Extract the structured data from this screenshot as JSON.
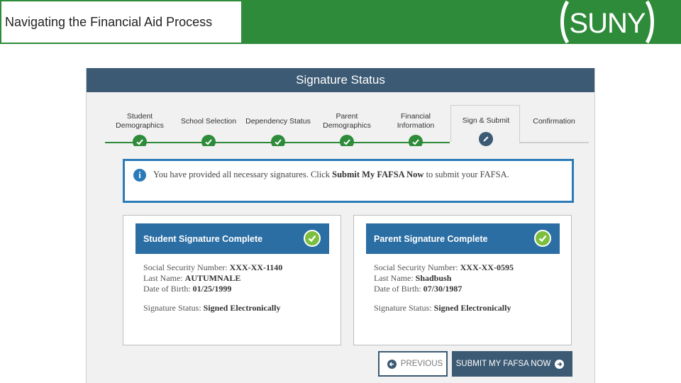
{
  "slide": {
    "title": "Navigating the Financial Aid Process",
    "logo_text": "SUNY",
    "colors": {
      "header_green": "#2e8b3a"
    }
  },
  "screen": {
    "title": "Signature Status",
    "steps": [
      {
        "line1": "Student",
        "line2": "Demographics",
        "state": "complete"
      },
      {
        "line1": "School Selection",
        "line2": "",
        "state": "complete"
      },
      {
        "line1": "Dependency Status",
        "line2": "",
        "state": "complete"
      },
      {
        "line1": "Parent",
        "line2": "Demographics",
        "state": "complete"
      },
      {
        "line1": "Financial",
        "line2": "Information",
        "state": "complete"
      },
      {
        "line1": "Sign & Submit",
        "line2": "",
        "state": "current"
      },
      {
        "line1": "Confirmation",
        "line2": "",
        "state": "upcoming"
      }
    ],
    "info": {
      "text_before": "You have provided all necessary signatures. Click ",
      "text_bold": "Submit My FAFSA Now",
      "text_after": " to submit your FAFSA."
    },
    "student_card": {
      "heading": "Student Signature Complete",
      "ssn_label": "Social Security Number:",
      "ssn_value": "XXX-XX-1140",
      "last_name_label": "Last Name:",
      "last_name_value": "AUTUMNALE",
      "dob_label": "Date of Birth:",
      "dob_value": "01/25/1999",
      "status_label": "Signature Status:",
      "status_value": "Signed Electronically"
    },
    "parent_card": {
      "heading": "Parent Signature Complete",
      "ssn_label": "Social Security Number:",
      "ssn_value": "XXX-XX-0595",
      "last_name_label": "Last Name:",
      "last_name_value": "Shadbush",
      "dob_label": "Date of Birth:",
      "dob_value": "07/30/1987",
      "status_label": "Signature Status:",
      "status_value": "Signed Electronically"
    },
    "buttons": {
      "previous": "PREVIOUS",
      "submit": "SUBMIT MY FAFSA NOW"
    },
    "colors": {
      "title_bar": "#3c5a73",
      "complete_green": "#2e8b3a",
      "info_blue": "#2b7bb9",
      "card_header": "#2b6ea4",
      "check_green": "#7cbf3f"
    }
  }
}
